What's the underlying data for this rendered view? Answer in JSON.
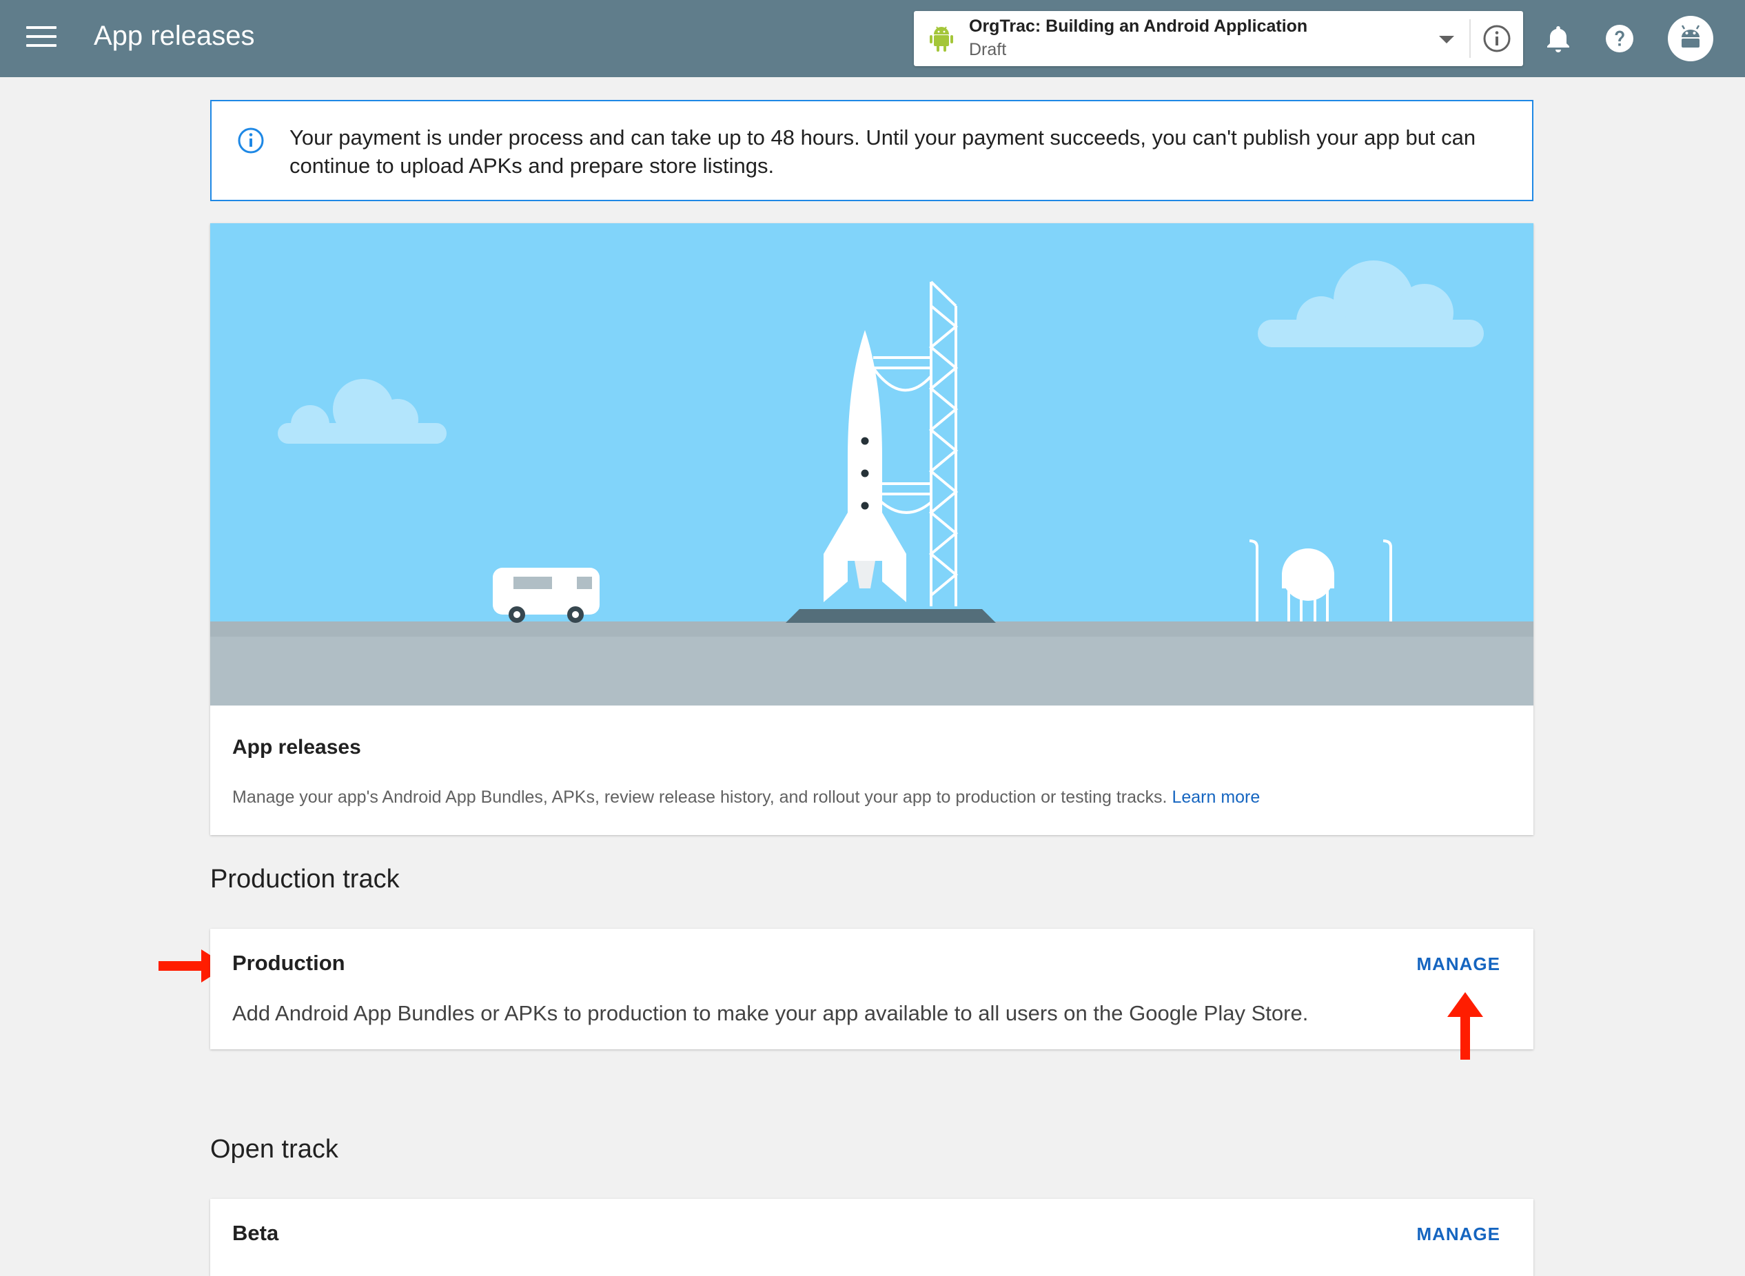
{
  "topbar": {
    "title": "App releases",
    "menu_icon": "menu-icon",
    "app": {
      "name": "OrgTrac: Building an Android Application",
      "status": "Draft",
      "icon": "android-icon"
    },
    "icons": [
      "info-icon",
      "bell-icon",
      "help-icon",
      "avatar"
    ]
  },
  "notice": {
    "icon": "info-icon",
    "text": "Your payment is under process and can take up to 48 hours. Until your payment succeeds, you can't publish your app but can continue to upload APKs and prepare store listings."
  },
  "hero": {
    "title": "App releases",
    "description": "Manage your app's Android App Bundles, APKs, review release history, and rollout your app to production or testing tracks.",
    "learn_more": "Learn more"
  },
  "sections": {
    "production_title": "Production track",
    "open_title": "Open track"
  },
  "production": {
    "name": "Production",
    "description": "Add Android App Bundles or APKs to production to make your app available to all users on the Google Play Store.",
    "action": "MANAGE"
  },
  "beta": {
    "name": "Beta",
    "action": "MANAGE"
  },
  "colors": {
    "topbar": "#607d8b",
    "accent": "#1565c0",
    "annotation_arrow": "#ff1d00",
    "sky": "#81d4fa"
  }
}
